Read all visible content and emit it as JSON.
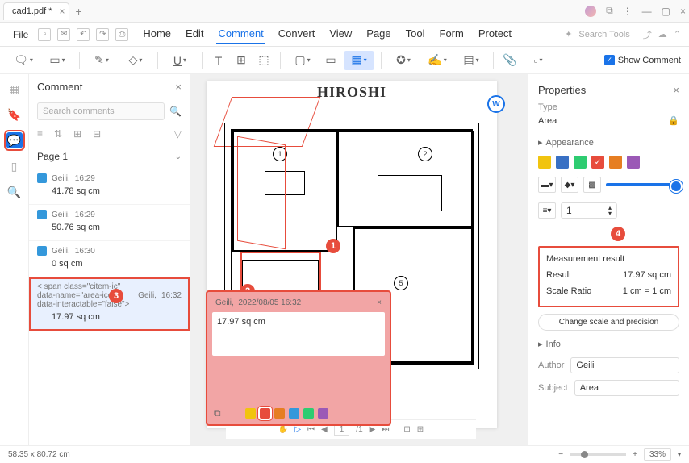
{
  "titlebar": {
    "filename": "cad1.pdf *"
  },
  "menu": {
    "file": "File",
    "tabs": [
      "Home",
      "Edit",
      "Comment",
      "Convert",
      "View",
      "Page",
      "Tool",
      "Form",
      "Protect"
    ],
    "active_tab": "Comment",
    "search_placeholder": "Search Tools"
  },
  "toolbar": {
    "show_comment": "Show Comment"
  },
  "comment_panel": {
    "title": "Comment",
    "search_placeholder": "Search comments",
    "page_label": "Page 1",
    "items": [
      {
        "author": "Geili,",
        "time": "16:29",
        "text": "41.78 sq cm"
      },
      {
        "author": "Geili,",
        "time": "16:29",
        "text": "50.76 sq cm"
      },
      {
        "author": "Geili,",
        "time": "16:30",
        "text": "0 sq cm"
      },
      {
        "author": "Geili,",
        "time": "16:32",
        "text": "17.97 sq cm"
      }
    ],
    "selected_index": 3
  },
  "doc": {
    "title": "HIROSHI"
  },
  "popup": {
    "author": "Geili,",
    "date": "2022/08/05 16:32",
    "text": "17.97 sq cm",
    "colors": [
      "#f1c40f",
      "#e74c3c",
      "#e67e22",
      "#3498db",
      "#2ecc71",
      "#9b59b6"
    ]
  },
  "properties": {
    "title": "Properties",
    "type_label": "Type",
    "type_value": "Area",
    "appearance_label": "Appearance",
    "swatches": [
      "#f1c40f",
      "#3970c4",
      "#2ecc71",
      "#e74c3c",
      "#e67e22",
      "#9b59b6"
    ],
    "swatch_selected": 3,
    "thickness": "1",
    "measurement": {
      "title": "Measurement result",
      "result_label": "Result",
      "result_value": "17.97 sq cm",
      "ratio_label": "Scale Ratio",
      "ratio_value": "1 cm = 1 cm"
    },
    "change_btn": "Change scale and precision",
    "info_label": "Info",
    "author_label": "Author",
    "author_value": "Geili",
    "subject_label": "Subject",
    "subject_value": "Area"
  },
  "statusbar": {
    "coords": "58.35 x 80.72 cm"
  },
  "pager": {
    "page": "1",
    "total": "/1",
    "zoom": "33%"
  },
  "markers": {
    "m1": "1",
    "m2": "2",
    "m3": "3",
    "m4": "4"
  }
}
